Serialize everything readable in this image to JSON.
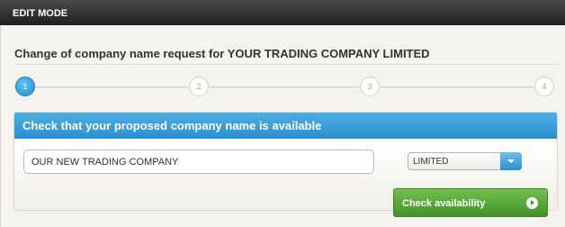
{
  "topbar": {
    "mode_label": "EDIT MODE"
  },
  "page": {
    "title": "Change of company name request for YOUR TRADING COMPANY LIMITED"
  },
  "steps": {
    "items": [
      {
        "number": "1",
        "active": true
      },
      {
        "number": "2",
        "active": false
      },
      {
        "number": "3",
        "active": false
      },
      {
        "number": "4",
        "active": false
      }
    ]
  },
  "card": {
    "heading": "Check that your proposed company name is available",
    "name_input": {
      "value": "OUR NEW TRADING COMPANY"
    },
    "suffix_select": {
      "selected": "LIMITED"
    }
  },
  "actions": {
    "check_label": "Check availability"
  },
  "colors": {
    "accent_blue": "#2a8fd0",
    "accent_green": "#3f9427",
    "topbar_dark": "#1f1f1f"
  }
}
